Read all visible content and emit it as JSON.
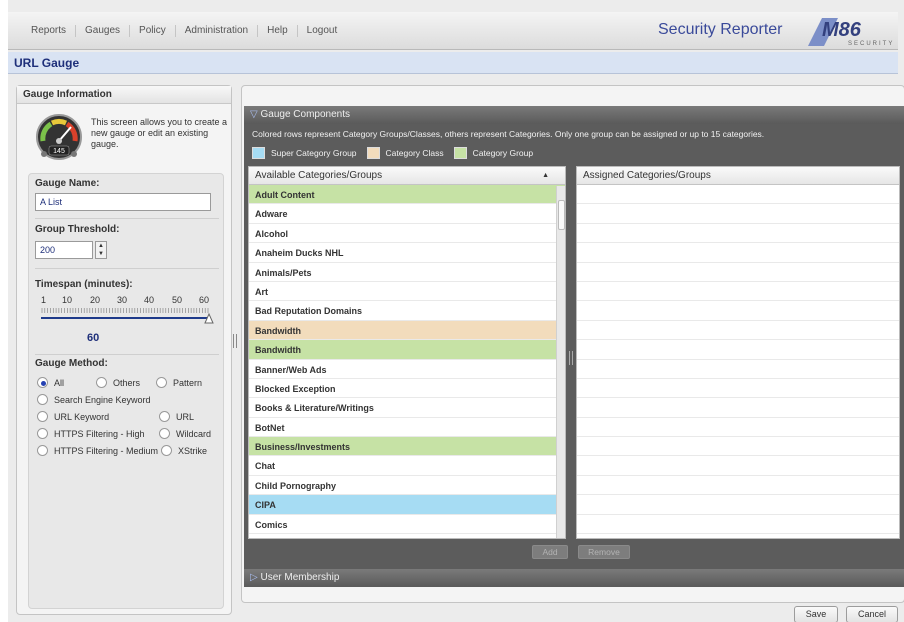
{
  "nav": {
    "items": [
      "Reports",
      "Gauges",
      "Policy",
      "Administration",
      "Help",
      "Logout"
    ],
    "app_title": "Security Reporter",
    "logo_text": "M86",
    "logo_sub": "SECURITY"
  },
  "page": {
    "title": "URL Gauge"
  },
  "gauge_info": {
    "header": "Gauge Information",
    "description": "This screen allows you to create a new gauge or edit an existing gauge.",
    "icon_value": "145",
    "name_label": "Gauge Name:",
    "name_value": "A List",
    "threshold_label": "Group Threshold:",
    "threshold_value": "200",
    "timespan_label": "Timespan (minutes):",
    "timespan_ticks": [
      "1",
      "10",
      "20",
      "30",
      "40",
      "50",
      "60"
    ],
    "timespan_value": "60",
    "timespan_fraction": 1.0,
    "method_label": "Gauge Method:",
    "methods": {
      "all": "All",
      "others": "Others",
      "pattern": "Pattern",
      "search_engine": "Search Engine Keyword",
      "url_keyword": "URL Keyword",
      "url": "URL",
      "https_high": "HTTPS Filtering - High",
      "wildcard": "Wildcard",
      "https_medium": "HTTPS Filtering - Medium",
      "xstrike": "XStrike"
    },
    "selected_method": "All"
  },
  "components": {
    "header": "Gauge Components",
    "note": "Colored rows represent Category Groups/Classes, others represent Categories.  Only one group can be assigned or up to 15 categories.",
    "legend": [
      {
        "label": "Super Category Group",
        "color": "#a6dcf3"
      },
      {
        "label": "Category Class",
        "color": "#f2dcbc"
      },
      {
        "label": "Category Group",
        "color": "#c6e2a5"
      }
    ],
    "available_header": "Available Categories/Groups",
    "assigned_header": "Assigned Categories/Groups",
    "available": [
      {
        "label": "Adult Content",
        "color": "#c6e2a5"
      },
      {
        "label": "Adware",
        "color": "#ffffff"
      },
      {
        "label": "Alcohol",
        "color": "#ffffff"
      },
      {
        "label": "Anaheim Ducks NHL",
        "color": "#ffffff"
      },
      {
        "label": "Animals/Pets",
        "color": "#ffffff"
      },
      {
        "label": "Art",
        "color": "#ffffff"
      },
      {
        "label": "Bad Reputation Domains",
        "color": "#ffffff"
      },
      {
        "label": "Bandwidth",
        "color": "#f2dcbc"
      },
      {
        "label": "Bandwidth",
        "color": "#c6e2a5"
      },
      {
        "label": "Banner/Web Ads",
        "color": "#ffffff"
      },
      {
        "label": "Blocked Exception",
        "color": "#ffffff"
      },
      {
        "label": "Books & Literature/Writings",
        "color": "#ffffff"
      },
      {
        "label": "BotNet",
        "color": "#ffffff"
      },
      {
        "label": "Business/Investments",
        "color": "#c6e2a5"
      },
      {
        "label": "Chat",
        "color": "#ffffff"
      },
      {
        "label": "Child Pornography",
        "color": "#ffffff"
      },
      {
        "label": "CIPA",
        "color": "#a6dcf3"
      },
      {
        "label": "Comics",
        "color": "#ffffff"
      }
    ],
    "add_label": "Add",
    "remove_label": "Remove"
  },
  "membership": {
    "header": "User Membership"
  },
  "footer": {
    "save_label": "Save",
    "cancel_label": "Cancel"
  }
}
